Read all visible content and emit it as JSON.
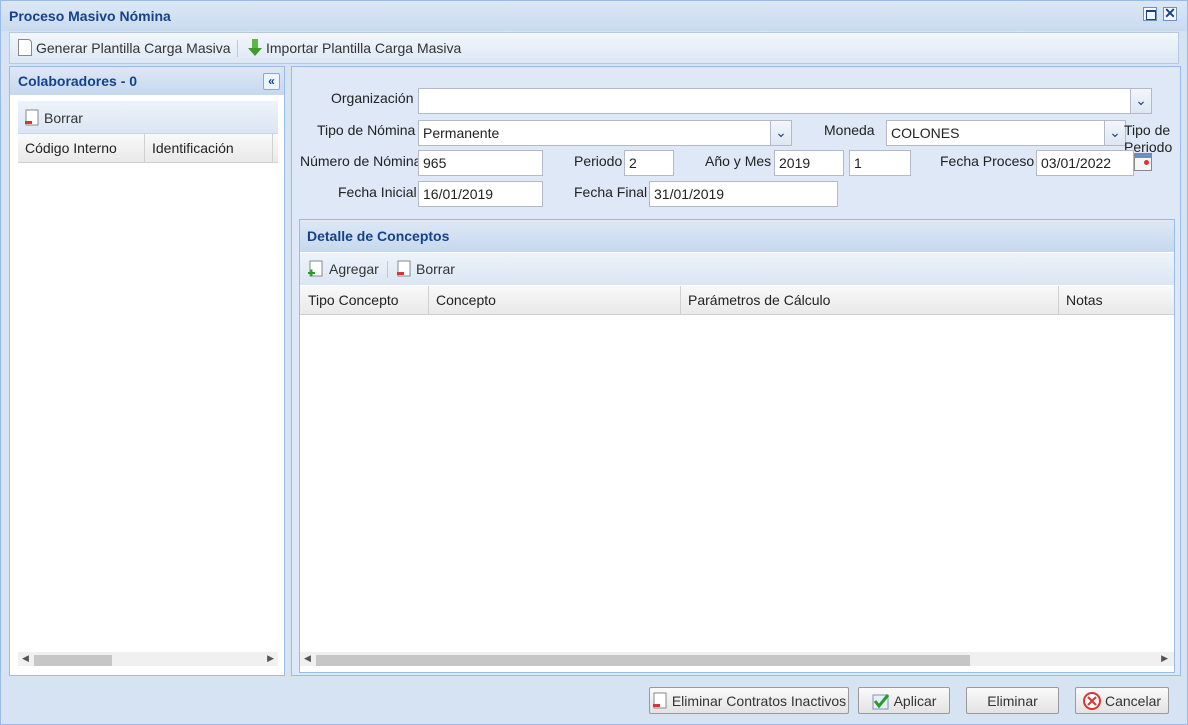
{
  "window": {
    "title": "Proceso Masivo Nómina"
  },
  "toolbar": {
    "generate_label": "Generar Plantilla Carga Masiva",
    "import_label": "Importar Plantilla Carga Masiva"
  },
  "collaborators": {
    "title": "Colaboradores - 0",
    "delete_label": "Borrar",
    "columns": [
      "Código Interno",
      "Identificación"
    ]
  },
  "form": {
    "organization_label": "Organización",
    "organization_value": "",
    "payroll_type_label": "Tipo de Nómina",
    "payroll_type_value": "Permanente",
    "currency_label": "Moneda",
    "currency_value": "COLONES",
    "period_type_label": "Tipo de Periodo",
    "payroll_number_label": "Número de Nómina",
    "payroll_number_value": "965",
    "period_label": "Periodo",
    "period_value": "2",
    "year_month_label": "Año y Mes",
    "year_value": "2019",
    "month_value": "1",
    "process_date_label": "Fecha Proceso",
    "process_date_value": "03/01/2022",
    "start_date_label": "Fecha Inicial",
    "start_date_value": "16/01/2019",
    "end_date_label": "Fecha Final",
    "end_date_value": "31/01/2019"
  },
  "concepts": {
    "title": "Detalle de Conceptos",
    "add_label": "Agregar",
    "delete_label": "Borrar",
    "columns": [
      "Tipo Concepto",
      "Concepto",
      "Parámetros de Cálculo",
      "Notas"
    ]
  },
  "footer": {
    "remove_inactive_label": "Eliminar Contratos Inactivos",
    "apply_label": "Aplicar",
    "delete_label": "Eliminar",
    "cancel_label": "Cancelar"
  },
  "colors": {
    "header_text": "#15428b",
    "border": "#99bbe8",
    "panel_bg": "#dfe8f6"
  },
  "icons": [
    "maximize-icon",
    "close-icon",
    "document-icon",
    "download-arrow-icon",
    "delete-doc-icon",
    "add-doc-icon",
    "collapse-left-icon",
    "dropdown-icon",
    "calendar-icon",
    "check-icon",
    "cancel-icon"
  ]
}
